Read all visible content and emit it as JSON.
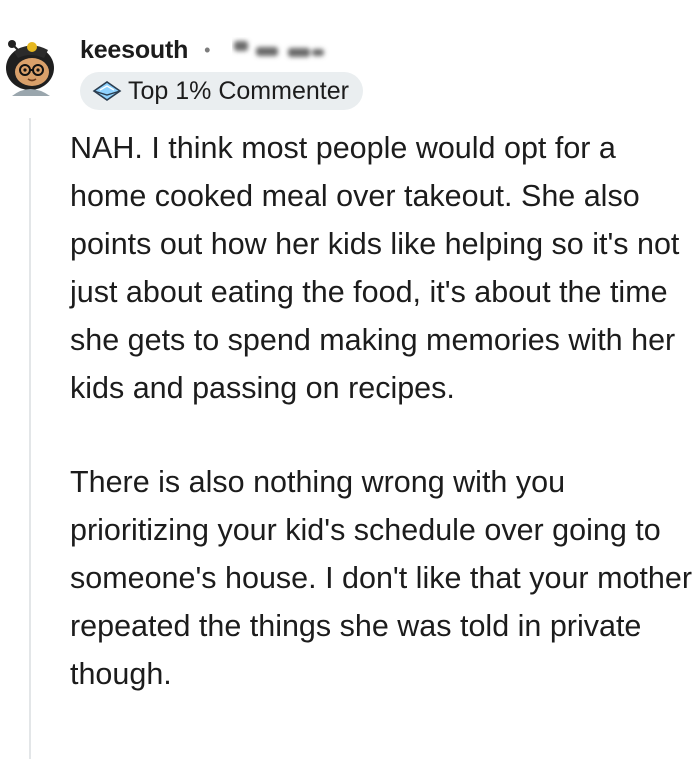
{
  "comment": {
    "username": "keesouth",
    "separator": "•",
    "avatar_icon": "snoo-avatar-icon",
    "timestamp_icon": "blurred-timestamp-icon",
    "badge": {
      "icon": "award-badge-icon",
      "label": "Top 1% Commenter"
    },
    "paragraphs": [
      "NAH. I think most people would opt for a home cooked meal over takeout. She also points out how her kids like helping so it's not just about eating the food, it's about the time she gets to spend making memories with her kids and passing on recipes.",
      "There is also nothing wrong with you prioritizing your kid's schedule over going to someone's house. I don't like that your mother repeated the things she was told in private though."
    ]
  },
  "colors": {
    "text": "#1c1c1c",
    "badge_background": "#eaeef0",
    "thread_line": "#e3e6e8",
    "muted": "#7c7c7c"
  }
}
